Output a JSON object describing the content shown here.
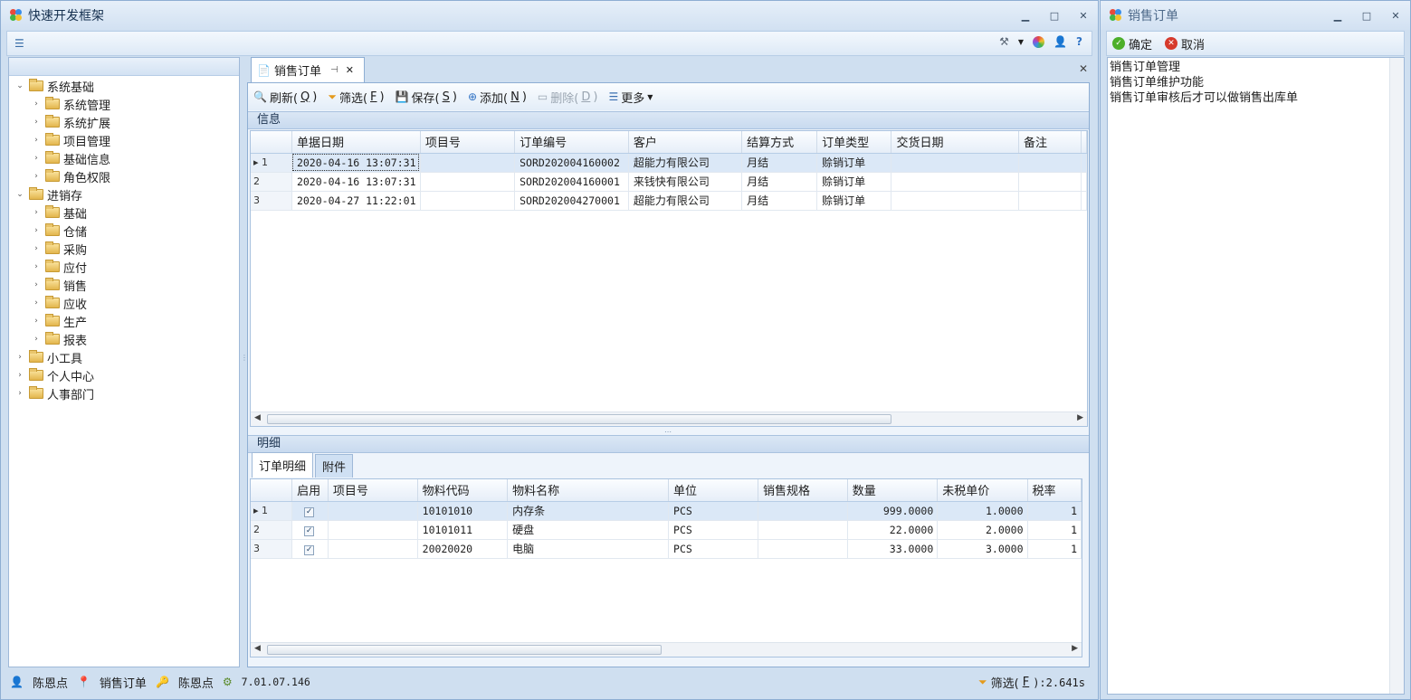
{
  "main": {
    "title": "快速开发框架",
    "nav": [
      {
        "label": "系统基础",
        "level": 0,
        "expanded": true
      },
      {
        "label": "系统管理",
        "level": 1,
        "expanded": false
      },
      {
        "label": "系统扩展",
        "level": 1,
        "expanded": false
      },
      {
        "label": "项目管理",
        "level": 1,
        "expanded": false
      },
      {
        "label": "基础信息",
        "level": 1,
        "expanded": false
      },
      {
        "label": "角色权限",
        "level": 1,
        "expanded": false
      },
      {
        "label": "进销存",
        "level": 0,
        "expanded": true
      },
      {
        "label": "基础",
        "level": 1,
        "expanded": false
      },
      {
        "label": "仓储",
        "level": 1,
        "expanded": false
      },
      {
        "label": "采购",
        "level": 1,
        "expanded": false
      },
      {
        "label": "应付",
        "level": 1,
        "expanded": false
      },
      {
        "label": "销售",
        "level": 1,
        "expanded": false
      },
      {
        "label": "应收",
        "level": 1,
        "expanded": false
      },
      {
        "label": "生产",
        "level": 1,
        "expanded": false
      },
      {
        "label": "报表",
        "level": 1,
        "expanded": false
      },
      {
        "label": "小工具",
        "level": 0,
        "expanded": false
      },
      {
        "label": "个人中心",
        "level": 0,
        "expanded": false
      },
      {
        "label": "人事部门",
        "level": 0,
        "expanded": false
      }
    ],
    "doc_tab": {
      "label": "销售订单"
    },
    "actions": {
      "refresh": "刷新(",
      "refresh_key": "Q",
      "filter": "筛选(",
      "filter_key": "F",
      "save": "保存(",
      "save_key": "S",
      "add": "添加(",
      "add_key": "N",
      "delete": "删除(",
      "delete_key": "D",
      "more": "更多",
      "close_paren": ")"
    },
    "info_group": "信息",
    "orders": {
      "columns": [
        "单据日期",
        "项目号",
        "订单编号",
        "客户",
        "结算方式",
        "订单类型",
        "交货日期",
        "备注"
      ],
      "rows": [
        {
          "no": "1",
          "date": "2020-04-16 13:07:31",
          "project": "",
          "order_no": "SORD202004160002",
          "customer": "超能力有限公司",
          "settle": "月结",
          "type": "赊销订单",
          "delivery": "",
          "note": ""
        },
        {
          "no": "2",
          "date": "2020-04-16 13:07:31",
          "project": "",
          "order_no": "SORD202004160001",
          "customer": "来钱快有限公司",
          "settle": "月结",
          "type": "赊销订单",
          "delivery": "",
          "note": ""
        },
        {
          "no": "3",
          "date": "2020-04-27 11:22:01",
          "project": "",
          "order_no": "SORD202004270001",
          "customer": "超能力有限公司",
          "settle": "月结",
          "type": "赊销订单",
          "delivery": "",
          "note": ""
        }
      ]
    },
    "detail_group": "明细",
    "subtabs": [
      "订单明细",
      "附件"
    ],
    "details": {
      "columns": [
        "启用",
        "项目号",
        "物料代码",
        "物料名称",
        "单位",
        "销售规格",
        "数量",
        "未税单价",
        "税率"
      ],
      "rows": [
        {
          "no": "1",
          "enabled": true,
          "project": "",
          "code": "10101010",
          "name": "内存条",
          "unit": "PCS",
          "spec": "",
          "qty": "999.0000",
          "price": "1.0000",
          "tax": "1"
        },
        {
          "no": "2",
          "enabled": true,
          "project": "",
          "code": "10101011",
          "name": "硬盘",
          "unit": "PCS",
          "spec": "",
          "qty": "22.0000",
          "price": "2.0000",
          "tax": "1"
        },
        {
          "no": "3",
          "enabled": true,
          "project": "",
          "code": "20020020",
          "name": "电脑",
          "unit": "PCS",
          "spec": "",
          "qty": "33.0000",
          "price": "3.0000",
          "tax": "1"
        }
      ]
    },
    "status": {
      "user": "陈恩点",
      "module": "销售订单",
      "user2": "陈恩点",
      "version": "7.01.07.146",
      "filter": "筛选(",
      "filter_key": "F",
      "time": "):2.641s"
    }
  },
  "side": {
    "title": "销售订单",
    "confirm": "确定",
    "cancel": "取消",
    "lines": [
      "销售订单管理",
      "销售订单维护功能",
      "销售订单审核后才可以做销售出库单"
    ]
  },
  "colors": {
    "accent": "#8eaed3",
    "selected_row": "#dbe8f7",
    "header_bg": "#cfdff0"
  }
}
